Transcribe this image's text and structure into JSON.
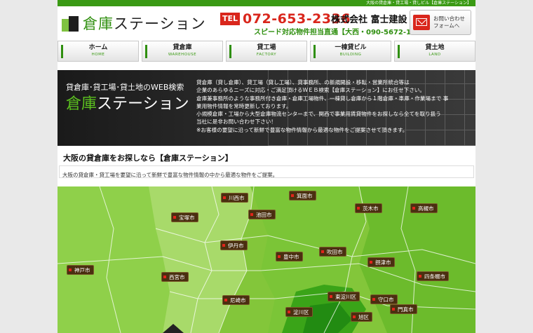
{
  "topbar": {
    "text": "大阪の貸倉庫・貸工場・貸しビル【倉庫ステーション】"
  },
  "logo": {
    "part1": "倉庫",
    "part2": "ステーション"
  },
  "contact": {
    "tel_label": "TEL",
    "tel_number": "072-653-2336",
    "company": "株式会社 富士建設",
    "subline": "スピード対応物件担当直通【大西・090-5672-1072】",
    "form_button": "お問い合わせ\nフォームへ"
  },
  "nav": [
    {
      "jp": "ホーム",
      "en": "HOME"
    },
    {
      "jp": "貸倉庫",
      "en": "WAREHOUSE"
    },
    {
      "jp": "貸工場",
      "en": "FACTORY"
    },
    {
      "jp": "一棟貸ビル",
      "en": "BUILDING"
    },
    {
      "jp": "貸土地",
      "en": "LAND"
    }
  ],
  "hero": {
    "tagline": "貸倉庫･貸工場･貸土地のWEB検索",
    "title_part1": "倉庫",
    "title_part2": "ステーション",
    "description": [
      "貸倉庫（貸し倉庫）、貸工場（貸し工場）、貸事務所、の新規開設・移転・営業所統合等は",
      "企業のあらゆるニーズに対応・ご満足頂けるＷＥＢ検索【倉庫ステーション】にお任せ下さい。",
      "倉庫兼事務所のような事務所付き倉庫・倉庫工場物件、一棟貸し倉庫から１階倉庫・車庫・作業場まで 事",
      "業用物件情報を常時更新しております。",
      "小規模倉庫・工場から大型倉庫物流センターまで、関西で事業用賃貸物件をお探しなら全てを取り扱う",
      "当社に是非お問い合わせ下さい！",
      "※お客様の要望に沿って新鮮で豊富な物件情報から最適な物件をご提案させて頂きます。"
    ]
  },
  "section": {
    "title": "大阪の貸倉庫をお探しなら【倉庫ステーション】",
    "text": "大阪の貸倉庫・貸工場を要望に沿って新鮮で豊富な物件情報の中から最適な物件をご提案。"
  },
  "colors": {
    "green": "#3a9a14",
    "red": "#d9261c",
    "label_bg": "#4a2f10"
  },
  "map": {
    "cities": [
      "川西市",
      "箕面市",
      "宝塚市",
      "池田市",
      "茨木市",
      "高槻市",
      "伊丹市",
      "豊中市",
      "吹田市",
      "摂津市",
      "神戸市",
      "西宮市",
      "四条畷市",
      "尼崎市",
      "東淀川区",
      "守口市",
      "淀川区",
      "門真市",
      "旭区"
    ]
  }
}
